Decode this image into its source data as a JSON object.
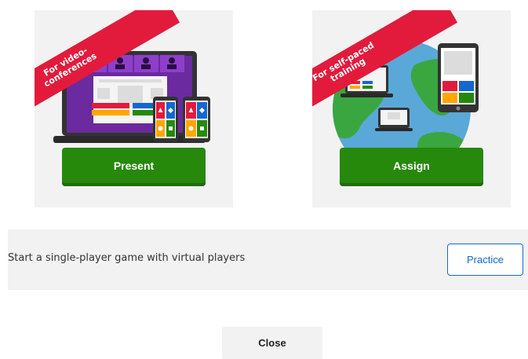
{
  "cards": [
    {
      "ribbon": "For video-conferences",
      "button_label": "Present",
      "illustration": "laptop-with-video-call-and-phones-icon"
    },
    {
      "ribbon": "For self-paced training",
      "button_label": "Assign",
      "illustration": "globe-with-devices-icon"
    }
  ],
  "practice": {
    "description": "Start a single-player game with virtual players",
    "button_label": "Practice"
  },
  "close_label": "Close",
  "colors": {
    "ribbon": "#e21b3c",
    "primary_green": "#26890c",
    "practice_blue": "#1368ce",
    "panel_gray": "#f2f2f2"
  }
}
